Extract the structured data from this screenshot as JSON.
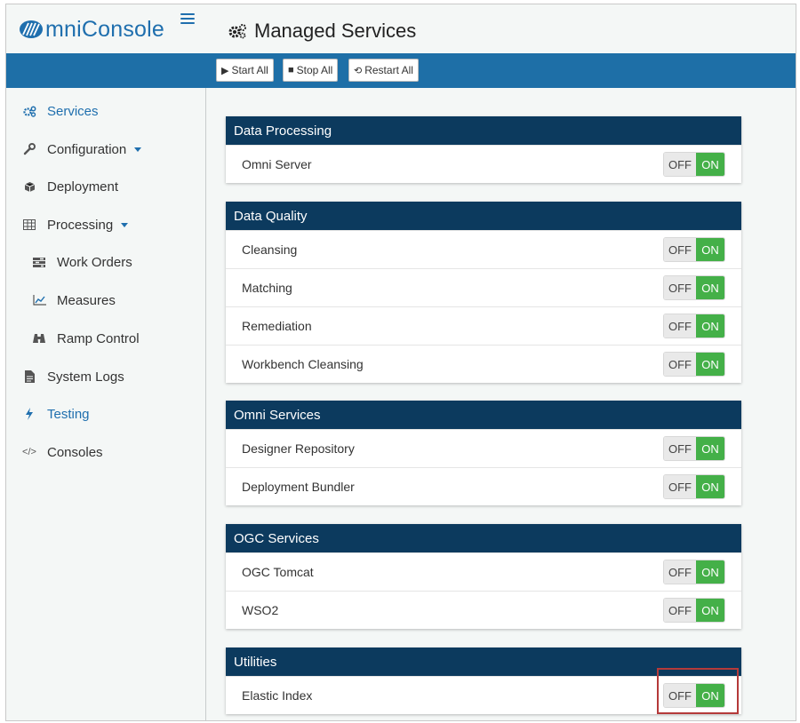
{
  "app": {
    "logo_text": "mniConsole",
    "page_title": "Managed Services"
  },
  "toolbar": {
    "start_all": "Start All",
    "stop_all": "Stop All",
    "restart_all": "Restart All"
  },
  "sidebar": {
    "items": [
      {
        "label": "Services",
        "icon": "cogs-icon",
        "active": true
      },
      {
        "label": "Configuration",
        "icon": "wrench-icon",
        "caret": true
      },
      {
        "label": "Deployment",
        "icon": "cube-icon"
      },
      {
        "label": "Processing",
        "icon": "table-icon",
        "caret": true
      },
      {
        "label": "Work Orders",
        "icon": "tasks-icon",
        "sub": true
      },
      {
        "label": "Measures",
        "icon": "line-chart-icon",
        "sub": true
      },
      {
        "label": "Ramp Control",
        "icon": "binoculars-icon",
        "sub": true
      },
      {
        "label": "System Logs",
        "icon": "file-icon"
      },
      {
        "label": "Testing",
        "icon": "bolt-icon",
        "active": true
      },
      {
        "label": "Consoles",
        "icon": "code-icon"
      }
    ]
  },
  "toggle": {
    "off": "OFF",
    "on": "ON"
  },
  "panels": [
    {
      "title": "Data Processing",
      "rows": [
        "Omni Server"
      ]
    },
    {
      "title": "Data Quality",
      "rows": [
        "Cleansing",
        "Matching",
        "Remediation",
        "Workbench Cleansing"
      ]
    },
    {
      "title": "Omni Services",
      "rows": [
        "Designer Repository",
        "Deployment Bundler"
      ]
    },
    {
      "title": "OGC Services",
      "rows": [
        "OGC Tomcat",
        "WSO2"
      ]
    },
    {
      "title": "Utilities",
      "rows": [
        "Elastic Index"
      ]
    }
  ],
  "colors": {
    "brand": "#1f6fae",
    "band": "#1e6fa7",
    "panel_header": "#0c3a5e",
    "toggle_on": "#44b048",
    "highlight": "#b53a3a"
  }
}
